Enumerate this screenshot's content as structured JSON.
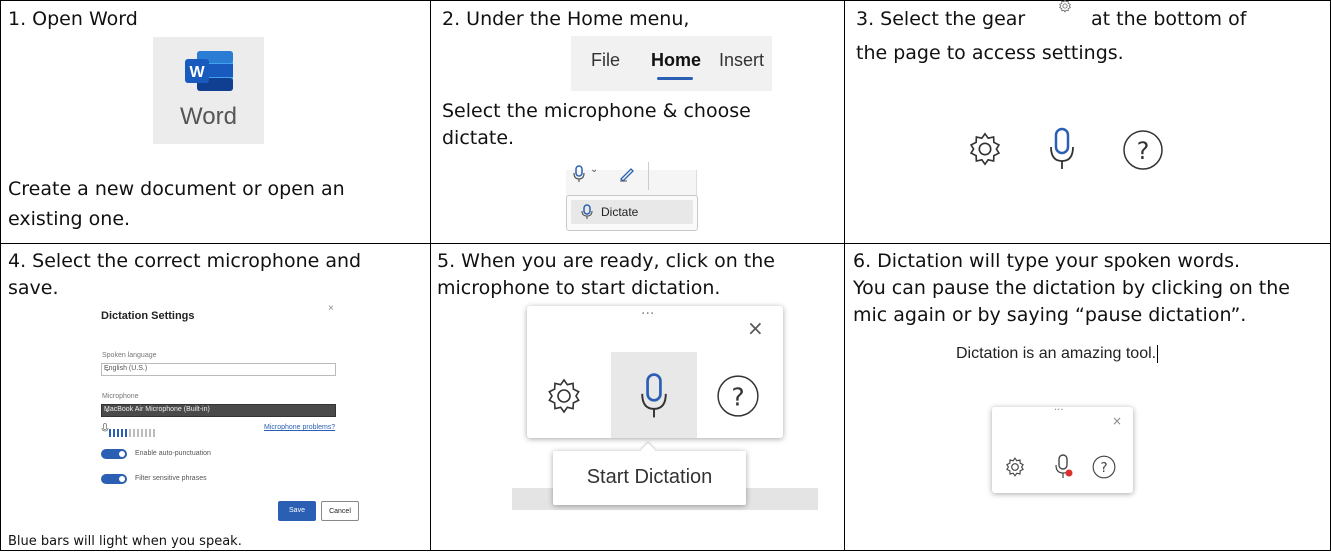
{
  "cells": {
    "c1": {
      "step": "1. Open Word",
      "app_label": "Word",
      "desc_line1": "Create a new document or open an",
      "desc_line2": "existing one."
    },
    "c2": {
      "step": "2. Under the Home menu,",
      "ribbon_tabs": [
        "File",
        "Home",
        "Insert"
      ],
      "desc_line1": "Select the microphone & choose",
      "desc_line2": "dictate.",
      "menu_item": "Dictate"
    },
    "c3": {
      "step_a": "3. Select the gear",
      "step_b": "at the bottom of",
      "step_line2": "the page to access settings.",
      "icons": [
        "gear-icon",
        "microphone-icon",
        "help-icon"
      ]
    },
    "c4": {
      "step_line1": "4. Select the correct microphone and",
      "step_line2": "save.",
      "dialog": {
        "title": "Dictation Settings",
        "close": "×",
        "language_label": "Spoken language",
        "language_value": "English (U.S.)",
        "mic_label": "Microphone",
        "mic_value": "MacBook Air Microphone (Built-in)",
        "mic_link": "Microphone problems?",
        "mic_level_lit": 5,
        "mic_level_total": 12,
        "toggle1": "Enable auto-punctuation",
        "toggle2": "Filter sensitive phrases",
        "save": "Save",
        "cancel": "Cancel"
      },
      "caption": "Blue bars will light when you speak."
    },
    "c5": {
      "step_line1": "5. When you are ready, click on the",
      "step_line2": "microphone to start dictation.",
      "tooltip": "Start Dictation",
      "close": "×",
      "dots": "···"
    },
    "c6": {
      "step_line1": "6. Dictation will type your spoken words.",
      "step_line2": "You can pause the dictation by clicking on the",
      "step_line3": "mic again or by saying “pause dictation”.",
      "sample_text": "Dictation is an amazing tool.",
      "close": "×",
      "dots": "···"
    }
  },
  "colors": {
    "word_blue": "#2b5fb4",
    "record_red": "#d9302c",
    "border": "#000000"
  }
}
